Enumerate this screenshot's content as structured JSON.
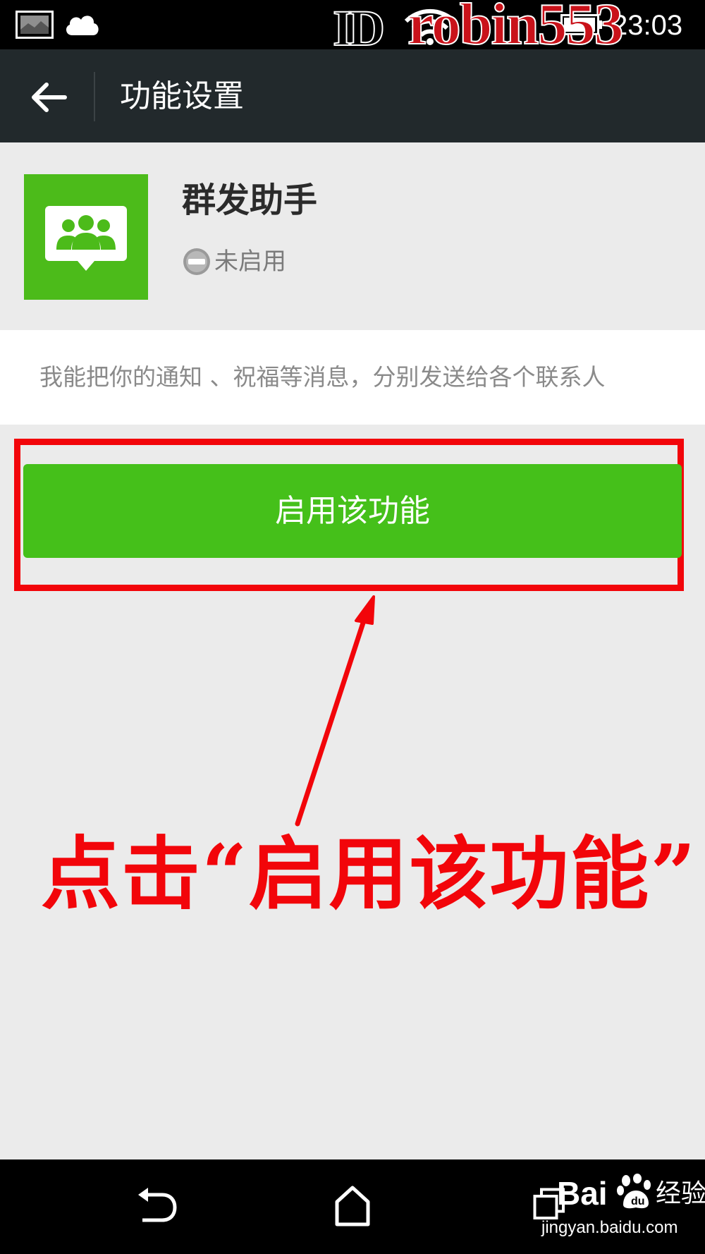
{
  "status_bar": {
    "time": "23:03",
    "icons": [
      "gallery-icon",
      "cloud-icon",
      "wifi-icon",
      "battery-icon"
    ],
    "watermark_id": "ID",
    "watermark_user": "robin553"
  },
  "app_bar": {
    "title": "功能设置",
    "back_icon": "arrow-left-icon"
  },
  "plugin": {
    "name": "群发助手",
    "status": "未启用",
    "status_icon": "minus-circle-icon",
    "icon": "group-chat-icon",
    "description": "我能把你的通知 、祝福等消息，分别发送给各个联系人"
  },
  "actions": {
    "enable_label": "启用该功能"
  },
  "annotation": {
    "text": "点击“启用该功能”",
    "color": "#f2050a"
  },
  "nav_bar": {
    "icons": [
      "back-icon",
      "home-icon",
      "recents-icon"
    ]
  },
  "watermark": {
    "brand": "Bai",
    "brand_suffix": "du",
    "product": "经验",
    "url": "jingyan.baidu.com"
  },
  "colors": {
    "accent_green": "#45c01a",
    "app_bar": "#22292c",
    "background": "#ebebeb"
  }
}
